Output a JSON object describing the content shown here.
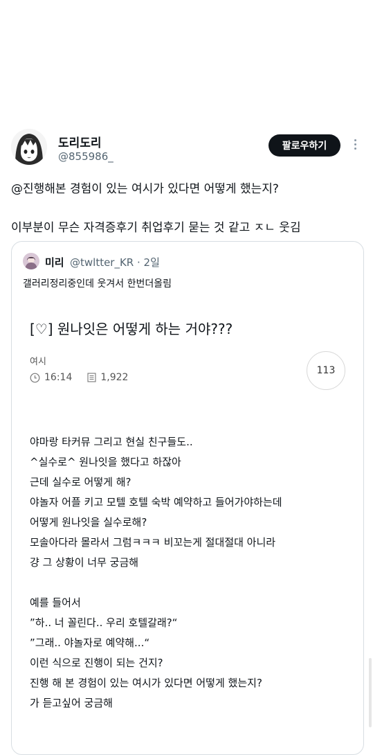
{
  "author": {
    "display_name": "도리도리",
    "handle": "@855986_",
    "avatar_icon": "anime-girl-avatar"
  },
  "follow_label": "팔로우하기",
  "tweet_lines": [
    "@진행해본 경험이 있는 여시가 있다면 어떻게 했는지?",
    "이부분이 무슨 자격증후기 취업후기 묻는 것 같고 ㅈㄴ 웃김"
  ],
  "quote": {
    "name": "미리",
    "meta": "@twltter_KR · 2일",
    "text": "갤러리정리중인데 웃겨서 한번더올림"
  },
  "post": {
    "title": "[♡] 원나잇은 어떻게 하는 거야???",
    "board": "여시",
    "time": "16:14",
    "views": "1,922",
    "comment_count": "113",
    "body_lines": [
      "야마랑 타커뮤 그리고 현실 친구들도..",
      "^실수로^ 원나잇을 했다고 하잖아",
      "근데 실수로 어떻게 해?",
      "야놀자 어플 키고 모텔 호텔 숙박 예약하고 들어가야하는데",
      "어떻게 원나잇을 실수로해?",
      "모솔아다라 몰라서 그럼ㅋㅋㅋ 비꼬는게 절대절대 아니라",
      "걍 그 상황이 너무 궁금해",
      "",
      "예를 들어서",
      "”하.. 너 꼴린다.. 우리 호텔갈래?“",
      "”그래.. 야놀자로 예약해...“",
      "이런 식으로 진행이 되는 건지?",
      "진행 해 본 경험이 있는 여시가 있다면 어떻게 했는지?",
      "가 듣고싶어 궁금해"
    ]
  },
  "colors": {
    "text": "#0f1419",
    "secondary": "#536471",
    "follow_bg": "#0f1419",
    "border": "#d7dde2"
  }
}
